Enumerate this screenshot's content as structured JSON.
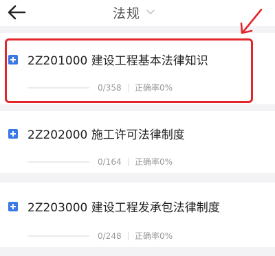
{
  "header": {
    "back_icon": "arrow-left-icon",
    "title": "法规",
    "dropdown_icon": "chevron-down-icon"
  },
  "chapters": [
    {
      "title": "2Z201000 建设工程基本法律知识",
      "count": "0/358",
      "accuracy": "正确率0%",
      "progress": 0
    },
    {
      "title": "2Z202000 施工许可法律制度",
      "count": "0/164",
      "accuracy": "正确率0%",
      "progress": 0
    },
    {
      "title": "2Z203000 建设工程发承包法律制度",
      "count": "0/248",
      "accuracy": "正确率0%",
      "progress": 0
    }
  ],
  "annotation": {
    "color": "#e3262b"
  }
}
